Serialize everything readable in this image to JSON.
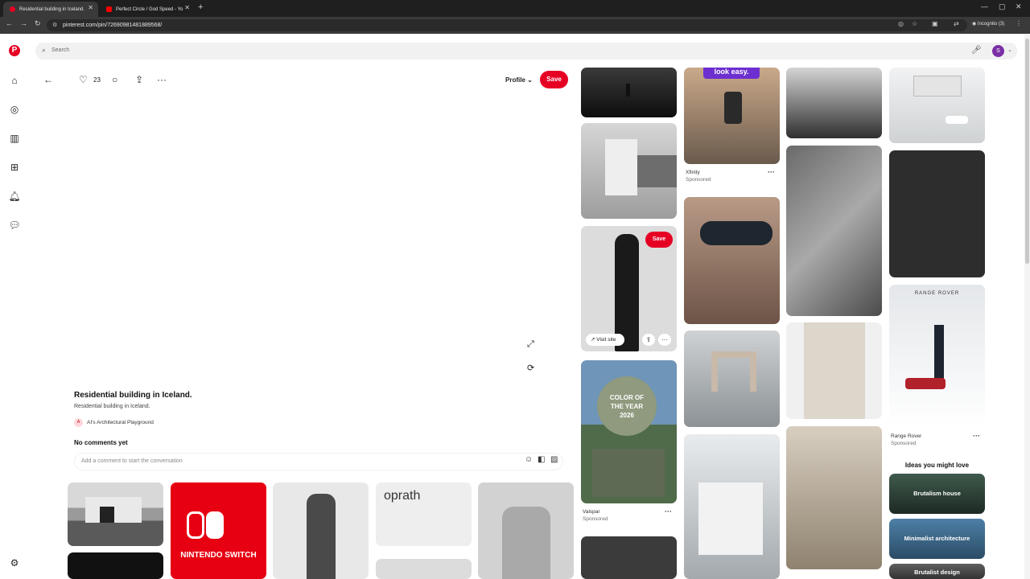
{
  "browser": {
    "tabs": [
      {
        "title": "Residential building in Iceland.",
        "active": true,
        "favicon_color": "#e60023"
      },
      {
        "title": "Perfect Circle / God Speed - Yo",
        "active": false,
        "favicon_color": "#ff0000"
      }
    ],
    "url": "pinterest.com/pin/72690981481889568/",
    "incognito_label": "Incognito (3)"
  },
  "search": {
    "placeholder": "Search"
  },
  "user": {
    "avatar_initial": "S",
    "avatar_color": "#7b2fa6"
  },
  "pin": {
    "like_count": "23",
    "profile_label": "Profile",
    "save_label": "Save",
    "title": "Residential building in Iceland.",
    "description": "Residential building in Iceland.",
    "creator": "AI's Architectural Playground",
    "creator_badge": "A",
    "comments_heading": "No comments yet",
    "comment_placeholder": "Add a comment to start the conversation"
  },
  "feed": {
    "tile_save_label": "Save",
    "visit_site_label": "Visit site",
    "xfinity": {
      "advertiser": "Xfinity",
      "tag": "Sponsored",
      "banner": "look easy."
    },
    "valspar": {
      "advertiser": "Valspar",
      "tag": "Sponsored",
      "caption_top": "COLOR OF",
      "caption_mid": "THE YEAR",
      "caption_year": "2026"
    },
    "range_rover": {
      "advertiser": "Range Rover",
      "tag": "Sponsored",
      "logo": "RANGE ROVER"
    },
    "oprath_logo": "oprath",
    "switch_logo": "NINTENDO SWITCH"
  },
  "ideas": {
    "heading": "Ideas you might love",
    "items": [
      "Brutalism house",
      "Minimalist architecture",
      "Brutalist design"
    ]
  },
  "colors": {
    "brand": "#e60023"
  }
}
